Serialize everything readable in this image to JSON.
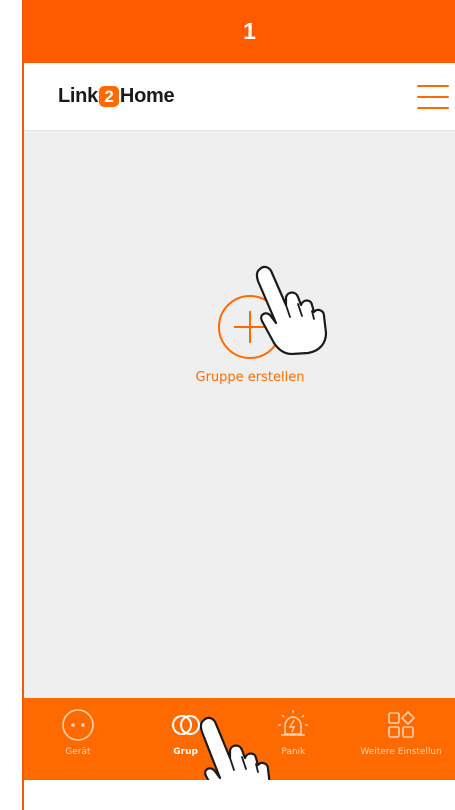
{
  "step": {
    "number": "1"
  },
  "header": {
    "logo_left": "Link",
    "logo_badge": "2",
    "logo_right": "Home",
    "menu_icon": "hamburger-menu-icon"
  },
  "main": {
    "create_group_label": "Gruppe erstellen",
    "plus_icon": "plus-circle-icon"
  },
  "tabs": [
    {
      "label": "Gerät",
      "icon": "socket-icon",
      "active": false
    },
    {
      "label": "Grup",
      "icon": "group-icon",
      "active": true
    },
    {
      "label": "Panik",
      "icon": "alarm-siren-icon",
      "active": false
    },
    {
      "label": "Weitere Einstellun",
      "icon": "grid-settings-icon",
      "active": false
    }
  ],
  "colors": {
    "accent": "#ff6a00",
    "banner": "#ff5a00",
    "content_background": "#efefef",
    "inactive_tab_label": "#ffd2b3"
  }
}
